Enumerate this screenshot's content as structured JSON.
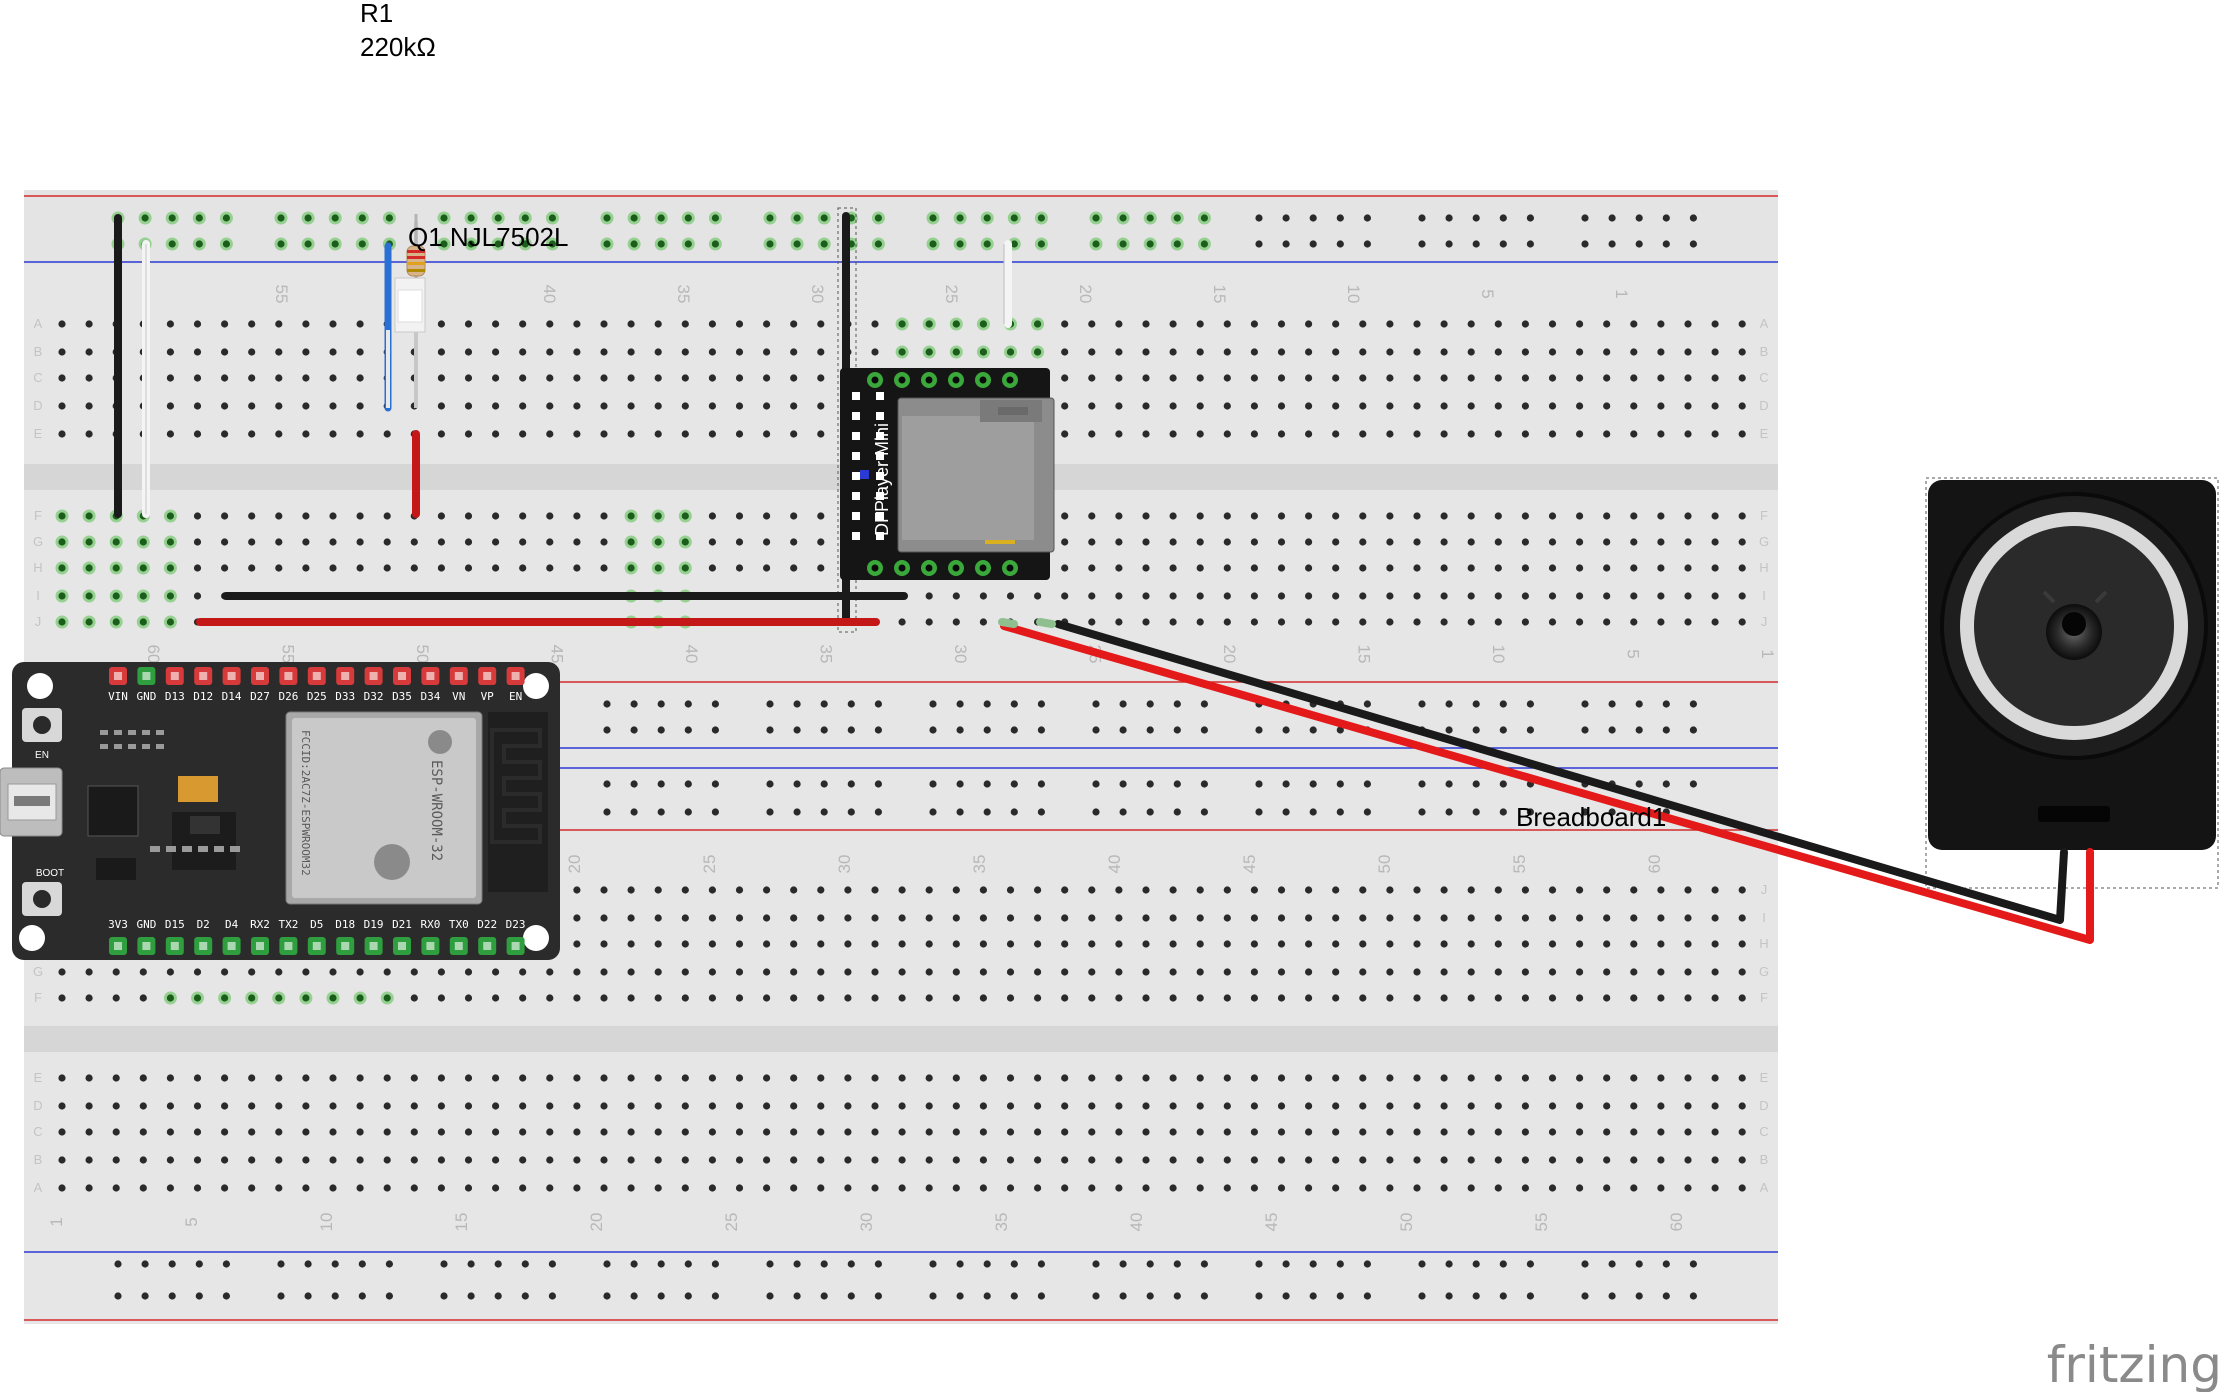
{
  "labels": {
    "r1_name": "R1",
    "r1_value": "220kΩ",
    "q1_label": "Q1 NJL7502L",
    "breadboard_label": "Breadboard1",
    "dfplayer_label": "DFPlayer Mini",
    "watermark": "fritzing",
    "esp_module_text": "ESP-WROOM-32",
    "esp_fcc": "FCCID:2AC7Z-ESPWROOM32",
    "esp_button_en": "EN",
    "esp_button_boot": "BOOT",
    "esp_top_pins": [
      "VIN",
      "GND",
      "D13",
      "D12",
      "D14",
      "D27",
      "D26",
      "D25",
      "D33",
      "D32",
      "D35",
      "D34",
      "VN",
      "VP",
      "EN"
    ],
    "esp_bottom_pins": [
      "3V3",
      "GND",
      "D15",
      "D2",
      "D4",
      "RX2",
      "TX2",
      "D5",
      "D18",
      "D19",
      "D21",
      "RX0",
      "TX0",
      "D22",
      "D23"
    ]
  },
  "upper_board": {
    "column_numbers": [
      "55",
      "45",
      "40",
      "35",
      "30",
      "25",
      "20",
      "15",
      "10",
      "5",
      "1",
      "60",
      "55",
      "50",
      "45",
      "40",
      "35",
      "30",
      "25",
      "20",
      "15",
      "10",
      "5",
      "1"
    ],
    "rows_top": [
      "A",
      "B",
      "C",
      "D",
      "E"
    ],
    "rows_bottom": [
      "F",
      "G",
      "H",
      "I",
      "J"
    ]
  },
  "lower_board": {
    "column_numbers": [
      "20",
      "25",
      "30",
      "35",
      "40",
      "45",
      "50",
      "55",
      "60",
      "1",
      "5",
      "10",
      "15",
      "20",
      "25",
      "30",
      "35",
      "40",
      "45",
      "50",
      "55",
      "60"
    ],
    "rows_top": [
      "J",
      "I",
      "H",
      "G",
      "F"
    ],
    "rows_bottom": [
      "E",
      "D",
      "C",
      "B",
      "A"
    ]
  },
  "colors": {
    "breadboard": "#e6e6e6",
    "hole": "#2a2a2a",
    "connected_hole": "#56c04d",
    "rail_red": "#d42a2a",
    "rail_blue": "#2a3ad4",
    "wire_black": "#1a1a1a",
    "wire_red": "#c41818",
    "wire_white": "#f4f4f4",
    "wire_blue": "#2a6fd4",
    "esp_board": "#2b2b2b",
    "pin_red": "#d63a3a",
    "pin_green": "#2e9e3e",
    "speaker": "#141414"
  }
}
